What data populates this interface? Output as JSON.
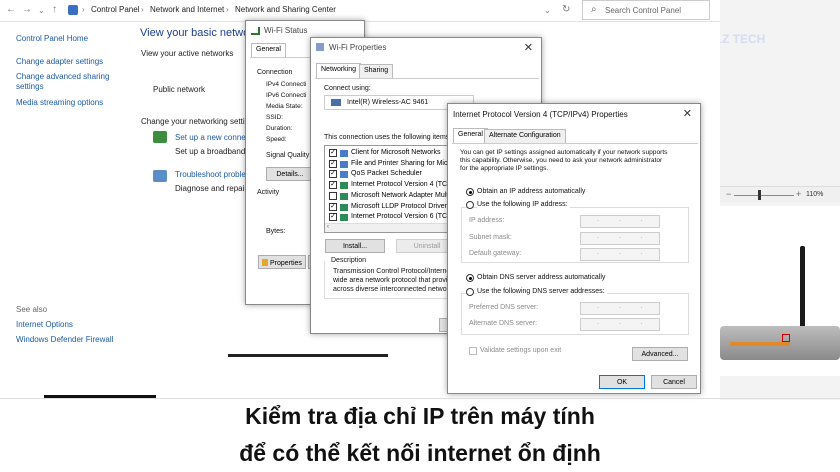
{
  "addressbar": {
    "breadcrumb": [
      "Control Panel",
      "Network and Internet",
      "Network and Sharing Center"
    ],
    "search_placeholder": "Search Control Panel"
  },
  "sidebar": {
    "home": "Control Panel Home",
    "links": [
      "Change adapter settings",
      "Change advanced sharing settings",
      "Media streaming options"
    ],
    "see_also": "See also",
    "see_also_links": [
      "Internet Options",
      "Windows Defender Firewall"
    ]
  },
  "main": {
    "heading": "View your basic networ",
    "active_networks": "View your active networks",
    "public_network": "Public network",
    "change_settings": "Change your networking settin",
    "setup_link": "Set up a new connec",
    "setup_desc": "Set up a broadband,",
    "troubleshoot_link": "Troubleshoot proble",
    "troubleshoot_desc": "Diagnose and repair"
  },
  "wifi_status": {
    "title": "Wi-Fi Status",
    "tab": "General",
    "connection": "Connection",
    "rows": [
      "IPv4 Connecti",
      "IPv6 Connecti",
      "Media State:",
      "SSID:",
      "Duration:",
      "Speed:"
    ],
    "signal": "Signal Quality:",
    "details_btn": "Details...",
    "activity": "Activity",
    "bytes": "Bytes:",
    "properties_btn": "Properties",
    "dis_btn": "D"
  },
  "wifi_props": {
    "title": "Wi-Fi Properties",
    "tabs": [
      "Networking",
      "Sharing"
    ],
    "connect_using": "Connect using:",
    "adapter": "Intel(R) Wireless-AC 9461",
    "uses_items": "This connection uses the following items",
    "items": [
      {
        "label": "Client for Microsoft Networks",
        "checked": true
      },
      {
        "label": "File and Printer Sharing for Microsoft",
        "checked": true
      },
      {
        "label": "QoS Packet Scheduler",
        "checked": true
      },
      {
        "label": "Internet Protocol Version 4 (TCP",
        "checked": true
      },
      {
        "label": "Microsoft Network Adapter Multi",
        "checked": false
      },
      {
        "label": "Microsoft LLDP Protocol Driver",
        "checked": true
      },
      {
        "label": "Internet Protocol Version 6 (TCP",
        "checked": true
      }
    ],
    "install_btn": "Install...",
    "uninstall_btn": "Uninstall",
    "description_label": "Description",
    "description": [
      "Transmission Control Protocol/Interne",
      "wide area network protocol that provi",
      "across diverse interconnected networ"
    ]
  },
  "ipv4": {
    "title": "Internet Protocol Version 4 (TCP/IPv4) Properties",
    "tabs": [
      "General",
      "Alternate Configuration"
    ],
    "intro": [
      "You can get IP settings assigned automatically if your network supports",
      "this capability. Otherwise, you need to ask your network administrator",
      "for the appropriate IP settings."
    ],
    "auto_ip": "Obtain an IP address automatically",
    "manual_ip": "Use the following IP address:",
    "ip_fields": [
      "IP address:",
      "Subnet mask:",
      "Default gateway:"
    ],
    "auto_dns": "Obtain DNS server address automatically",
    "manual_dns": "Use the following DNS server addresses:",
    "dns_fields": [
      "Preferred DNS server:",
      "Alternate DNS server:"
    ],
    "dots": ". . .",
    "validate": "Validate settings upon exit",
    "advanced_btn": "Advanced...",
    "ok_btn": "OK",
    "cancel_btn": "Cancel"
  },
  "background": {
    "brand": "DLZ TECH",
    "zoom": "110%"
  },
  "caption": {
    "line1": "Kiểm tra địa chỉ IP trên máy tính",
    "line2": "để có thể kết nối internet ổn định"
  }
}
